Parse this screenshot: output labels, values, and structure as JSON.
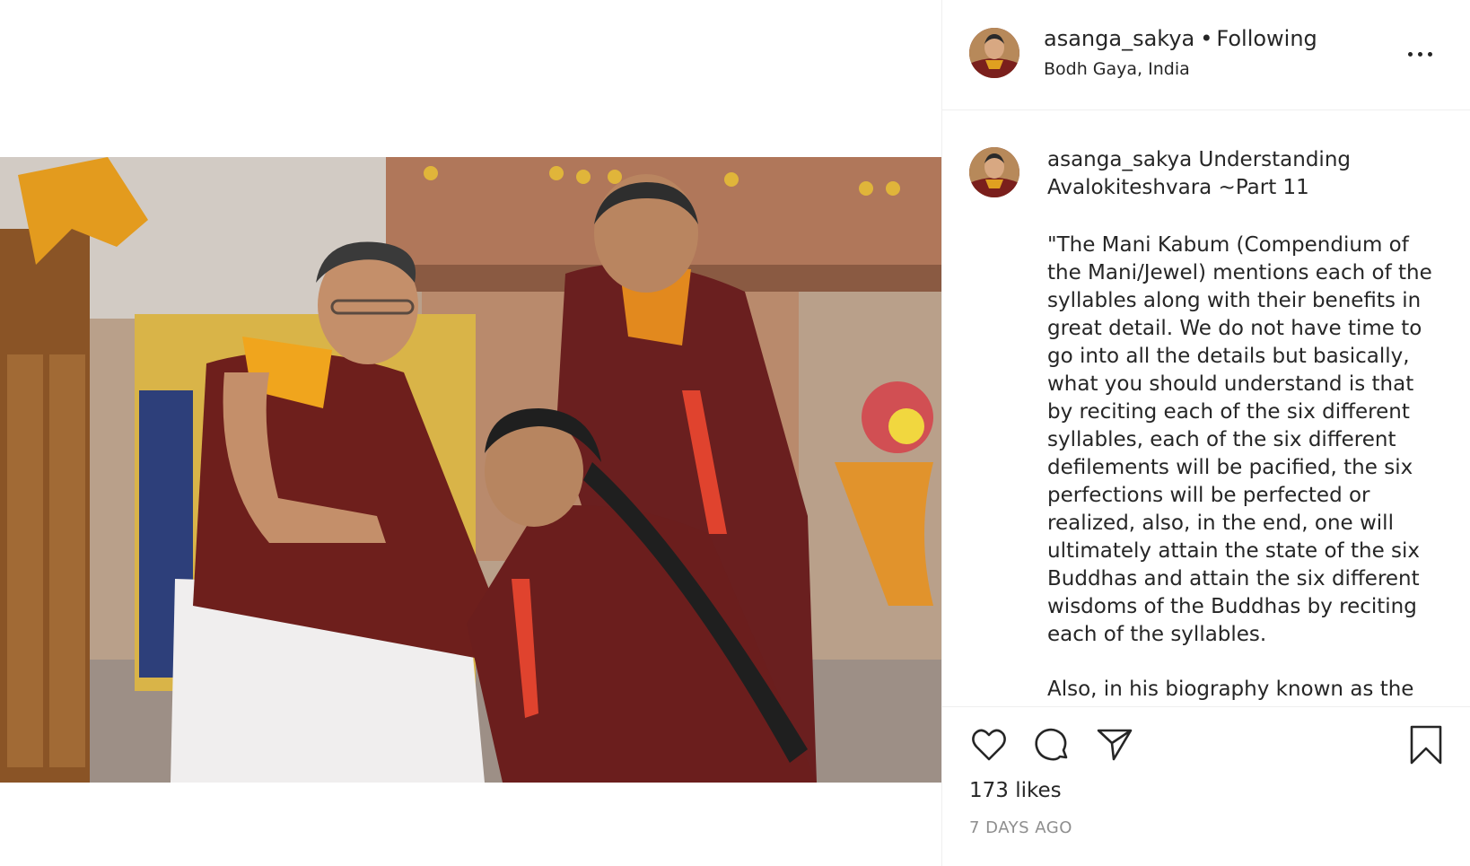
{
  "header": {
    "username": "asanga_sakya",
    "separator": "•",
    "follow_status": "Following",
    "location": "Bodh Gaya, India"
  },
  "caption": {
    "username": "asanga_sakya",
    "title": "Understanding Avalokiteshvara ~Part 11",
    "paragraph1": "\"The Mani Kabum (Compendium of the Mani/Jewel) mentions each of the syllables along with their benefits in great detail. We do not have time to go into all the details but basically, what you should understand is that by reciting each of the six different syllables, each of the six different defilements will be pacified, the six perfections will be perfected or realized, also, in the end, one will ultimately attain the state of the six Buddhas and attain the six different wisdoms of the Buddhas by reciting each of the syllables.",
    "paragraph2": "Also, in his biography known as the"
  },
  "stats": {
    "likes": "173 likes",
    "timestamp": "7 DAYS AGO"
  },
  "icons": {
    "like": "heart-icon",
    "comment": "comment-icon",
    "share": "send-icon",
    "save": "bookmark-icon",
    "more": "more-options-icon"
  },
  "colors": {
    "text": "#262626",
    "secondary": "#8e8e8e",
    "border": "#efefef",
    "robe": "#7a2a22"
  }
}
